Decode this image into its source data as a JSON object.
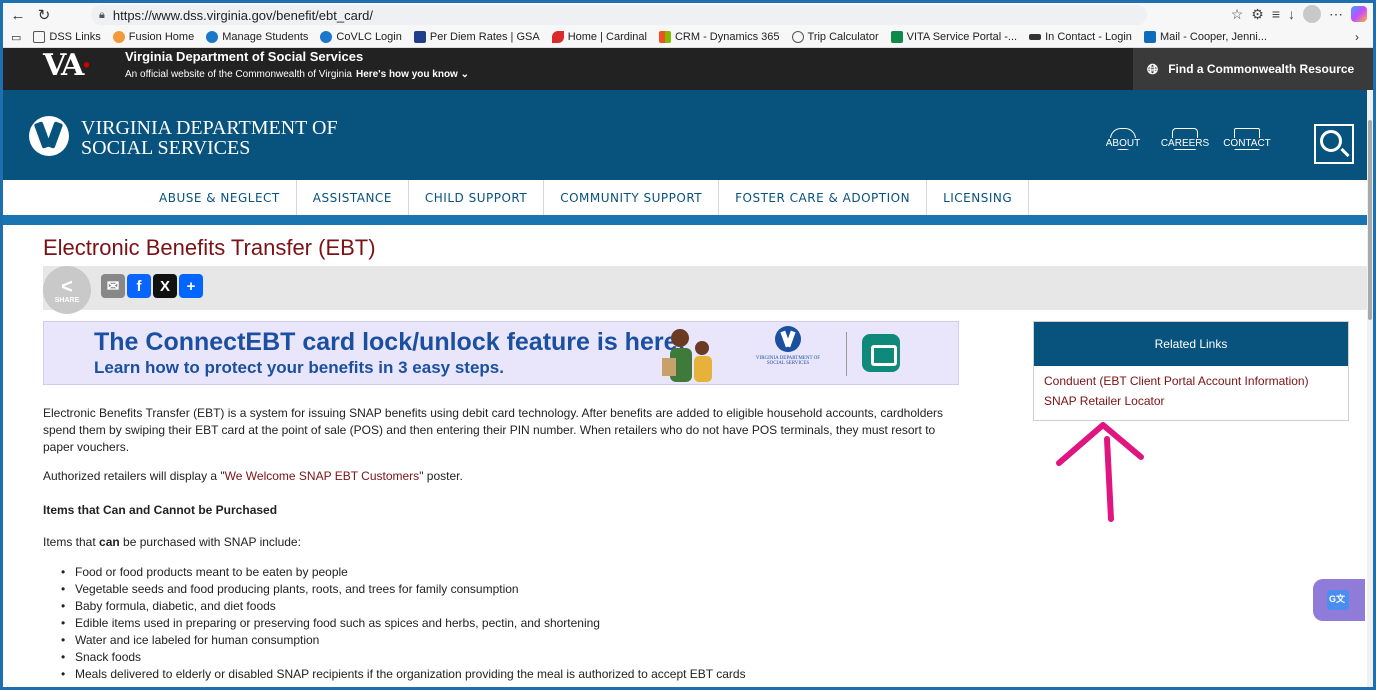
{
  "browser": {
    "url": "https://www.dss.virginia.gov/benefit/ebt_card/",
    "bookmarks": [
      "DSS Links",
      "Fusion Home",
      "Manage Students",
      "CoVLC Login",
      "Per Diem Rates | GSA",
      "Home | Cardinal",
      "CRM - Dynamics 365",
      "Trip Calculator",
      "VITA Service Portal -...",
      "In Contact - Login",
      "Mail - Cooper, Jenni..."
    ]
  },
  "topstrip": {
    "title": "Virginia Department of Social Services",
    "subtitle": "An official website of the Commonwealth of Virginia",
    "how_link": "Here's how you know ⌄",
    "find_resource": "Find a Commonwealth Resource"
  },
  "header": {
    "title_line1": "VIRGINIA DEPARTMENT OF",
    "title_line2": "SOCIAL SERVICES",
    "about": "ABOUT",
    "careers": "CAREERS",
    "contact": "CONTACT"
  },
  "nav": {
    "items": [
      "ABUSE & NEGLECT",
      "ASSISTANCE",
      "CHILD SUPPORT",
      "COMMUNITY SUPPORT",
      "FOSTER CARE & ADOPTION",
      "LICENSING"
    ]
  },
  "page": {
    "title": "Electronic Benefits Transfer (EBT)",
    "share_label": "SHARE",
    "banner_headline": "The ConnectEBT card lock/unlock feature is here!",
    "banner_sub": "Learn how to protect your benefits in 3 easy steps.",
    "banner_org": "VIRGINIA DEPARTMENT OF SOCIAL SERVICES",
    "intro": "Electronic Benefits Transfer (EBT) is a system for issuing SNAP benefits using debit card technology. After benefits are added to eligible household accounts, cardholders spend them by swiping their EBT card at the point of sale (POS) and then entering their PIN number. When retailers who do not have POS terminals, they must resort to paper vouchers.",
    "authorized_pre": "Authorized retailers will display a \"",
    "authorized_link": "We Welcome SNAP EBT Customers",
    "authorized_post": "\" poster.",
    "items_heading": "Items that Can and Cannot be Purchased",
    "items_can_pre": "Items that ",
    "items_can_bold": "can",
    "items_can_post": " be purchased with SNAP include:",
    "items": [
      "Food or food products meant to be eaten by people",
      "Vegetable seeds and food producing plants, roots, and trees for family consumption",
      "Baby formula, diabetic, and diet foods",
      "Edible items used in preparing or preserving food such as spices and herbs, pectin, and shortening",
      "Water and ice labeled for human consumption",
      "Snack foods",
      "Meals delivered to elderly or disabled SNAP recipients if the organization providing the meal is authorized to accept EBT cards"
    ]
  },
  "related": {
    "heading": "Related Links",
    "links": [
      "Conduent (EBT Client Portal Account Information)",
      "SNAP Retailer Locator"
    ]
  },
  "colors": {
    "brand_blue": "#08527e",
    "link_red": "#7b1216",
    "annotation_arrow": "#e0157f"
  }
}
